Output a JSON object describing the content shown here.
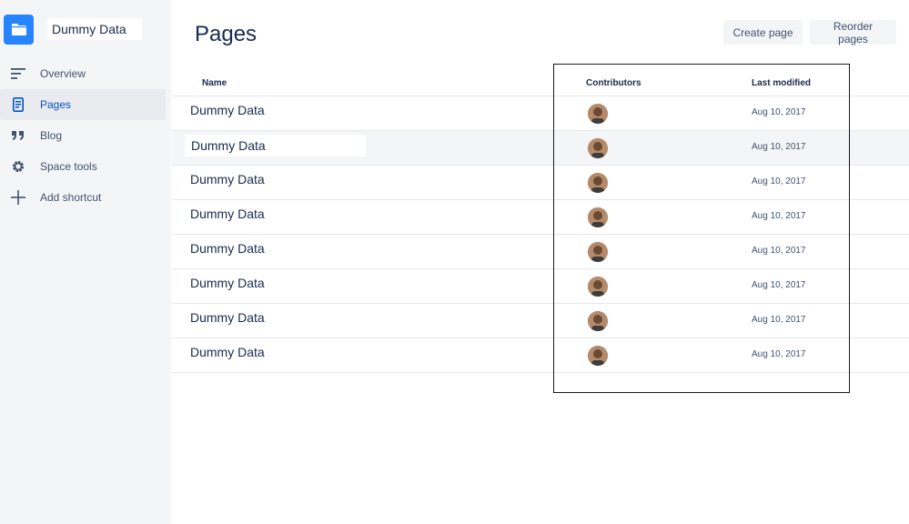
{
  "sidebar": {
    "space_name": "Dummy Data",
    "items": [
      {
        "label": "Overview",
        "icon": "overview-icon",
        "active": false
      },
      {
        "label": "Pages",
        "icon": "pages-icon",
        "active": true
      },
      {
        "label": "Blog",
        "icon": "blog-quote-icon",
        "active": false
      },
      {
        "label": "Space tools",
        "icon": "gear-icon",
        "active": false
      },
      {
        "label": "Add shortcut",
        "icon": "plus-icon",
        "active": false
      }
    ]
  },
  "main": {
    "title": "Pages",
    "buttons": {
      "create": "Create page",
      "reorder": "Reorder pages"
    },
    "table": {
      "columns": {
        "name": "Name",
        "contributors": "Contributors",
        "last_modified": "Last modified"
      },
      "rows": [
        {
          "name": "Dummy Data",
          "last_modified": "Aug 10, 2017"
        },
        {
          "name": "Dummy Data",
          "last_modified": "Aug 10, 2017"
        },
        {
          "name": "Dummy Data",
          "last_modified": "Aug 10, 2017"
        },
        {
          "name": "Dummy Data",
          "last_modified": "Aug 10, 2017"
        },
        {
          "name": "Dummy Data",
          "last_modified": "Aug 10, 2017"
        },
        {
          "name": "Dummy Data",
          "last_modified": "Aug 10, 2017"
        },
        {
          "name": "Dummy Data",
          "last_modified": "Aug 10, 2017"
        },
        {
          "name": "Dummy Data",
          "last_modified": "Aug 10, 2017"
        }
      ]
    }
  },
  "colors": {
    "accent": "#2684ff",
    "active_text": "#0052cc",
    "sidebar_bg": "#f4f5f7"
  }
}
